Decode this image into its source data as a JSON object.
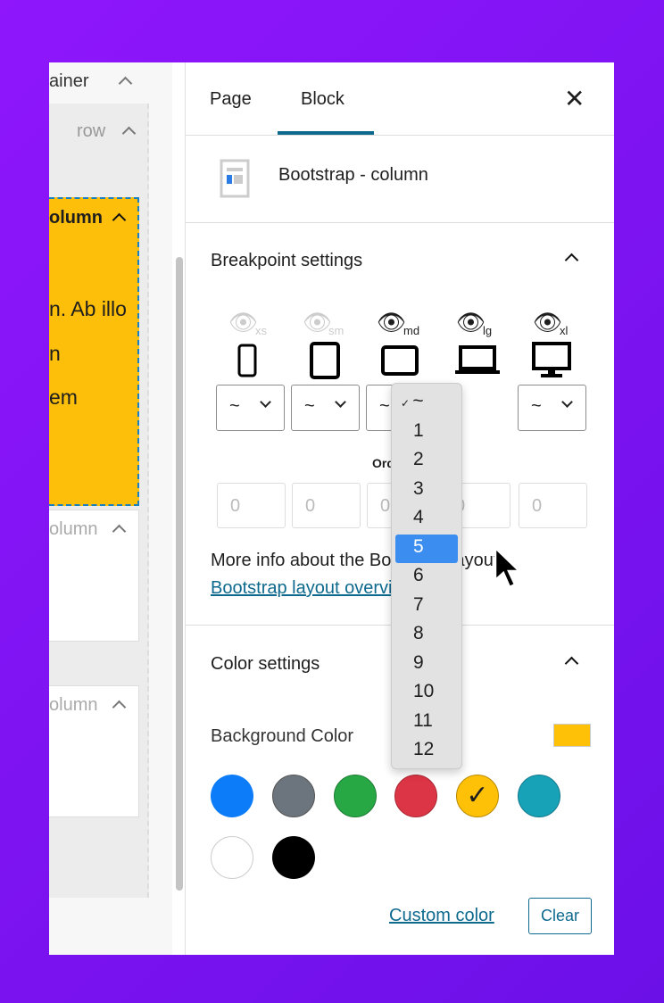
{
  "editor": {
    "container_label": "ainer",
    "row_label": "row",
    "column_label": "olumn",
    "text_lines": [
      "n. Ab illo",
      "n",
      "em"
    ],
    "column2_label": "olumn",
    "column3_label": "olumn"
  },
  "sidebar": {
    "tabs": [
      {
        "label": "Page",
        "active": false
      },
      {
        "label": "Block",
        "active": true
      }
    ],
    "block_title": "Bootstrap - column",
    "breakpoint": {
      "title": "Breakpoint settings",
      "breakpoints": [
        {
          "label": "xs",
          "visible": false,
          "device": "phone",
          "value": "~"
        },
        {
          "label": "sm",
          "visible": false,
          "device": "tablet",
          "value": "~"
        },
        {
          "label": "md",
          "visible": true,
          "device": "tablet-landscape",
          "value": "~"
        },
        {
          "label": "lg",
          "visible": true,
          "device": "laptop",
          "value": "~"
        },
        {
          "label": "xl",
          "visible": true,
          "device": "desktop",
          "value": "~"
        }
      ],
      "ordering_label": "Ordering",
      "ordering_values": [
        "0",
        "0",
        "0",
        "0",
        "0"
      ],
      "info_text": "More info about the Bootstrap layout:",
      "link_text": "Bootstrap layout overview"
    },
    "dropdown": {
      "options": [
        "~",
        "1",
        "2",
        "3",
        "4",
        "5",
        "6",
        "7",
        "8",
        "9",
        "10",
        "11",
        "12"
      ],
      "checked": "~",
      "highlighted": "5"
    },
    "color": {
      "title": "Color settings",
      "bg_label": "Background Color",
      "current": "#ffc107",
      "swatches": [
        "#0d7cf8",
        "#6c757d",
        "#28a745",
        "#dc3545",
        "#ffc107",
        "#17a2b8",
        "#ffffff",
        "#000000"
      ],
      "selected": "#ffc107",
      "custom_label": "Custom color",
      "clear_label": "Clear"
    },
    "accent": "#0d6a8e"
  }
}
